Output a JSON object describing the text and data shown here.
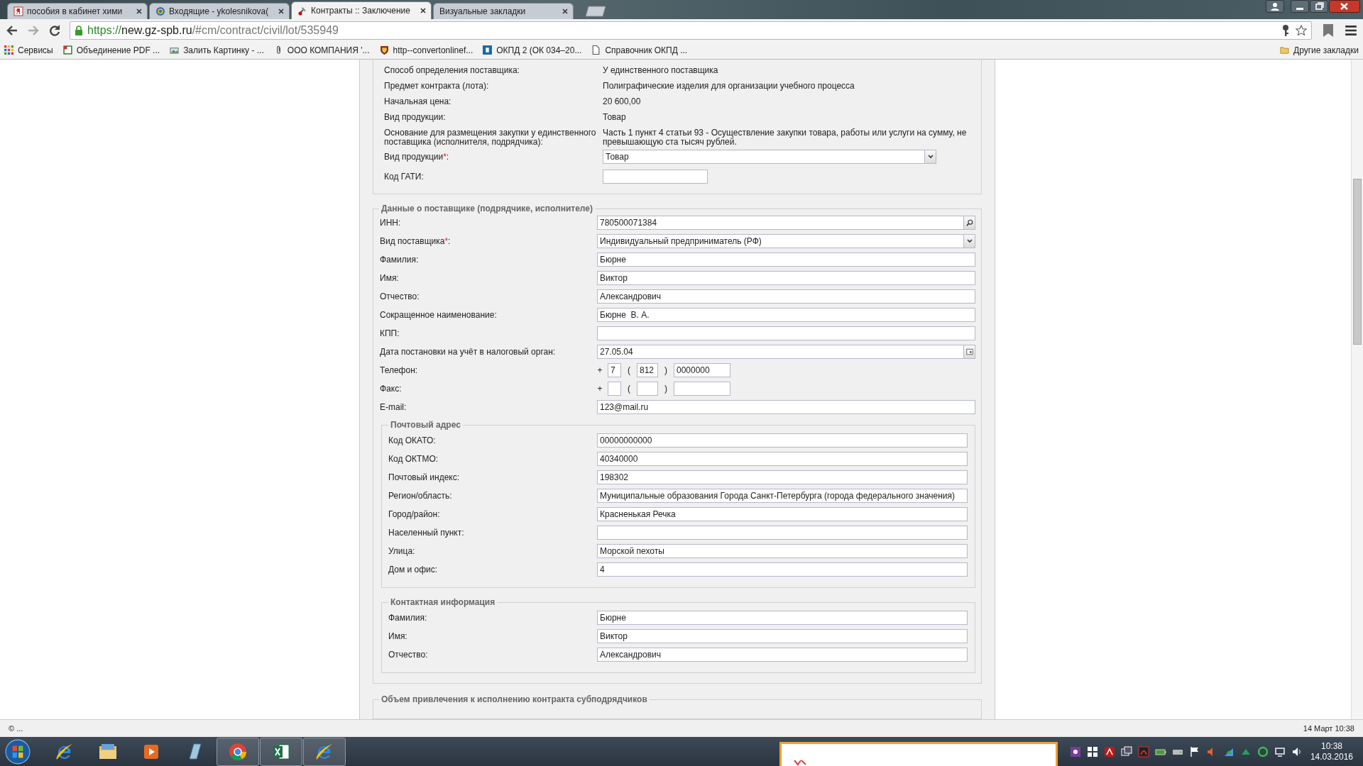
{
  "browser": {
    "tabs": [
      {
        "label": "пособия в кабинет хими",
        "selected": false
      },
      {
        "label": "Входящие - ykolesnikova(",
        "selected": false
      },
      {
        "label": "Контракты :: Заключение",
        "selected": true
      },
      {
        "label": "Визуальные закладки",
        "selected": false
      }
    ],
    "address": {
      "scheme": "https://",
      "host": "new.gz-spb.ru",
      "path": "/#cm/contract/civil/lot/535949"
    },
    "bookmarks": [
      "Сервисы",
      "Объединение PDF ...",
      "Залить Картинку - ...",
      "ООО КОМПАНИЯ '...",
      "http--convertonlinef...",
      "ОКПД 2 (ОК 034–20...",
      "Справочник ОКПД ..."
    ],
    "other_bookmarks": "Другие закладки"
  },
  "contract": {
    "rows": [
      {
        "label": "Способ определения поставщика:",
        "value": "У единственного поставщика"
      },
      {
        "label": "Предмет контракта (лота):",
        "value": "Полиграфические изделия для организации учебного процесса"
      },
      {
        "label": "Начальная цена:",
        "value": "20 600,00"
      },
      {
        "label": "Вид продукции:",
        "value": "Товар"
      },
      {
        "label": "Основание для размещения закупки у единственного поставщика (исполнителя, подрядчика):",
        "value": "Часть 1 пункт 4 статьи 93 - Осуществление закупки товара, работы или услуги на сумму, не превышающую ста тысяч рублей."
      }
    ],
    "fields": [
      {
        "kind": "select",
        "label": "Вид продукции",
        "required": true,
        "label_end": ":",
        "value": "Товар"
      },
      {
        "kind": "short",
        "label": "Код ГАТИ:",
        "required": false
      }
    ]
  },
  "required_mark": "*",
  "supplier": {
    "title": "Данные о поставщике (подрядчике, исполнителе)",
    "fields": [
      {
        "kind": "search",
        "label": "ИНН:",
        "required": false,
        "value": "780500071384"
      },
      {
        "kind": "select",
        "label": "Вид поставщика",
        "required": true,
        "label_end": ":",
        "value": "Индивидуальный предприниматель (РФ)"
      },
      {
        "kind": "text",
        "label": "Фамилия:",
        "required": false,
        "value": "Бюрне"
      },
      {
        "kind": "text",
        "label": "Имя:",
        "required": false,
        "value": "Виктор"
      },
      {
        "kind": "text",
        "label": "Отчество:",
        "required": false,
        "value": "Александрович"
      },
      {
        "kind": "text",
        "label": "Сокращенное наименование:",
        "required": false,
        "value": "Бюрне  В. А."
      },
      {
        "kind": "text",
        "label": "КПП:",
        "required": false
      },
      {
        "kind": "date",
        "label": "Дата постановки на учёт в налоговый орган:",
        "required": false,
        "value": "27.05.04"
      },
      {
        "kind": "phone",
        "label": "Телефон:",
        "required": false,
        "plus": "+",
        "open": "(",
        "close": ")",
        "country": "7",
        "code": "812",
        "number": "0000000"
      },
      {
        "kind": "phone",
        "label": "Факс:",
        "required": false,
        "plus": "+",
        "open": "(",
        "close": ")"
      },
      {
        "kind": "text",
        "label": "E-mail:",
        "required": false,
        "value": "123@mail.ru"
      }
    ],
    "postal": {
      "title": "Почтовый адрес",
      "fields": [
        {
          "label": "Код ОКАТО:",
          "value": "00000000000"
        },
        {
          "label": "Код ОКТМО:",
          "value": "40340000"
        },
        {
          "label": "Почтовый индекс:",
          "value": "198302"
        },
        {
          "label": "Регион/область:",
          "value": "Муниципальные образования Города Санкт-Петербурга (города федерального значения)"
        },
        {
          "label": "Город/район:",
          "value": "Красненькая Речка"
        },
        {
          "label": "Населенный пункт:"
        },
        {
          "label": "Улица:",
          "value": "Морской пехоты"
        },
        {
          "label": "Дом и офис:",
          "value": "4"
        }
      ]
    },
    "contact": {
      "title": "Контактная информация",
      "fields": [
        {
          "label": "Фамилия:",
          "value": "Бюрне"
        },
        {
          "label": "Имя:",
          "value": "Виктор"
        },
        {
          "label": "Отчество:",
          "value": "Александрович"
        }
      ]
    }
  },
  "next_section": {
    "title": "Объем привлечения к исполнению контракта субподрядчиков"
  },
  "status_bar": {
    "left": "© ...",
    "right": "14 Март 10:38"
  },
  "taskbar": {
    "time": "10:38",
    "date": "14.03.2016"
  }
}
